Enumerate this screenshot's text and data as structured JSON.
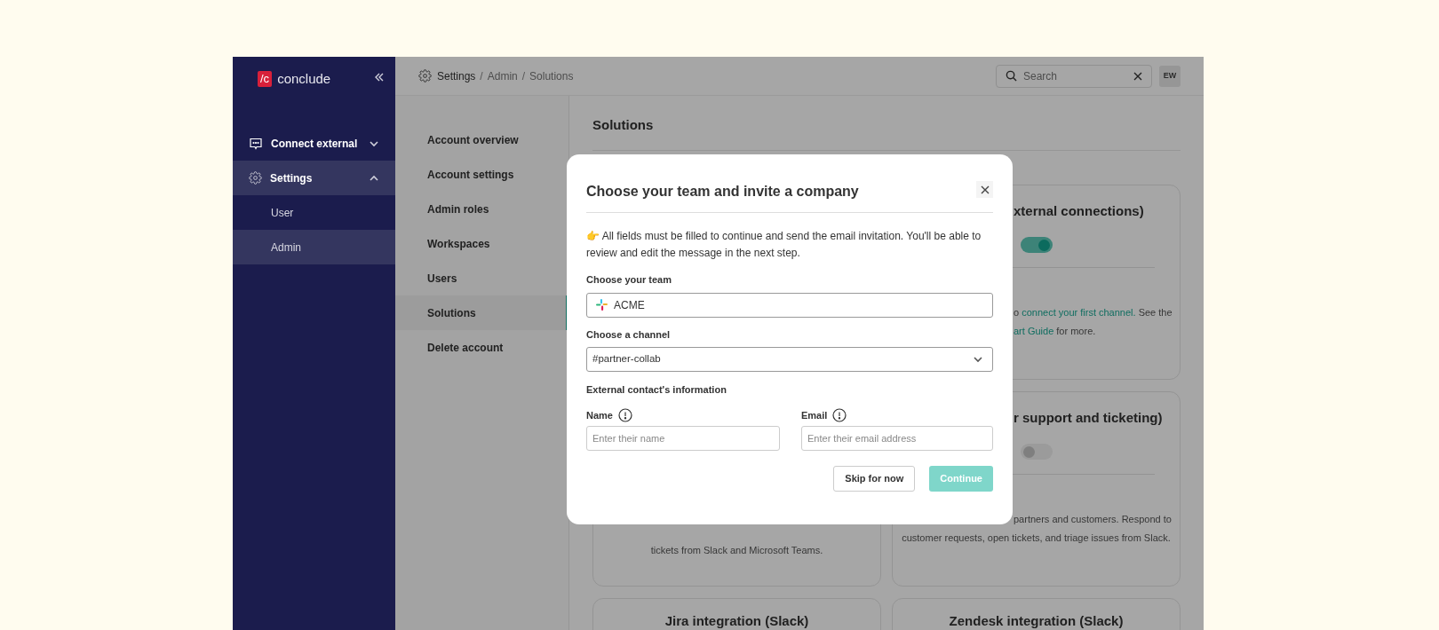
{
  "logo": {
    "mark": "/c",
    "name": "conclude"
  },
  "sidebar": {
    "items": [
      {
        "label": "Connect external",
        "expanded": false,
        "selected": false
      },
      {
        "label": "Settings",
        "expanded": true,
        "selected": true,
        "children": [
          {
            "label": "User",
            "selected": false
          },
          {
            "label": "Admin",
            "selected": true
          }
        ]
      }
    ]
  },
  "breadcrumb": {
    "separator": "/",
    "items": [
      "Settings",
      "Admin",
      "Solutions"
    ]
  },
  "search": {
    "placeholder": "Search"
  },
  "avatar": "EW",
  "settings_nav": [
    {
      "label": "Account overview",
      "selected": false
    },
    {
      "label": "Account settings",
      "selected": false
    },
    {
      "label": "Admin roles",
      "selected": false
    },
    {
      "label": "Workspaces",
      "selected": false
    },
    {
      "label": "Users",
      "selected": false
    },
    {
      "label": "Solutions",
      "selected": true
    },
    {
      "label": "Delete account",
      "selected": false
    }
  ],
  "page_title": "Solutions",
  "cards": [
    {
      "kind": "cut",
      "title": "xternal connections)",
      "toggle": {
        "on": true
      },
      "lines": [
        {
          "kind": "cut",
          "parts": [
            {
              "text": "o "
            },
            {
              "text": "connect your first channel.",
              "link": true
            },
            {
              "text": " See the"
            }
          ]
        },
        {
          "kind": "cut",
          "parts": [
            {
              "text": "art Guide",
              "link": true
            },
            {
              "text": " for more."
            }
          ]
        }
      ]
    },
    {
      "kind": "whole",
      "lines": [
        {
          "kind": "whole",
          "parts": [
            {
              "text": "tickets from Slack and Microsoft Teams."
            }
          ]
        }
      ]
    },
    {
      "kind": "cut",
      "title": "r support and ticketing)",
      "toggle": {
        "on": false
      },
      "lines": [
        {
          "kind": "cut",
          "parts": [
            {
              "text": "partners and customers. Respond to"
            }
          ]
        },
        {
          "kind": "whole",
          "parts": [
            {
              "text": "customer requests, open tickets, and triage issues from Slack."
            }
          ]
        }
      ]
    },
    {
      "kind": "whole",
      "title": "Jira integration (Slack)"
    },
    {
      "kind": "whole",
      "title": "Zendesk integration (Slack)"
    }
  ],
  "modal": {
    "title": "Choose your team and invite a company",
    "intro": "👉 All fields must be filled to continue and send the email invitation. You'll be able to review and edit the message in the next step.",
    "team": {
      "label": "Choose your team",
      "value": "ACME"
    },
    "channel": {
      "label": "Choose a channel",
      "value": "#partner-collab"
    },
    "contact_heading": "External contact's information",
    "name": {
      "label": "Name",
      "placeholder": "Enter their name"
    },
    "email": {
      "label": "Email",
      "placeholder": "Enter their email address"
    },
    "buttons": [
      {
        "label": "Skip for now",
        "kind": "secondary"
      },
      {
        "label": "Continue",
        "kind": "primary",
        "disabled": true
      }
    ]
  }
}
